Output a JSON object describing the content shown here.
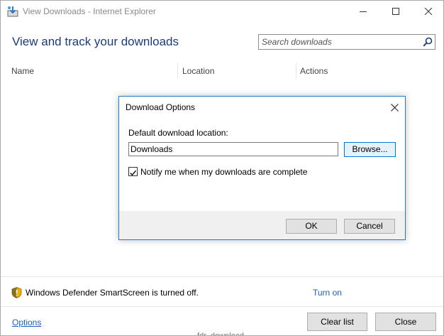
{
  "window": {
    "title": "View Downloads - Internet Explorer"
  },
  "header": {
    "title": "View and track your downloads",
    "search_placeholder": "Search downloads"
  },
  "columns": [
    "Name",
    "Location",
    "Actions"
  ],
  "dialog": {
    "title": "Download Options",
    "location_label": "Default download location:",
    "location_value": "Downloads",
    "browse_label": "Browse...",
    "notify_label": "Notify me when my downloads are complete",
    "notify_checked": true,
    "ok_label": "OK",
    "cancel_label": "Cancel"
  },
  "smartscreen": {
    "message": "Windows Defender SmartScreen is turned off.",
    "action_label": "Turn on"
  },
  "footer": {
    "options_label": "Options",
    "clear_label": "Clear list",
    "close_label": "Close",
    "partial_text": "fdr_download"
  },
  "colors": {
    "accent": "#1c3b7a",
    "link": "#1e5eb8",
    "dialog_border": "#2b78c2"
  }
}
